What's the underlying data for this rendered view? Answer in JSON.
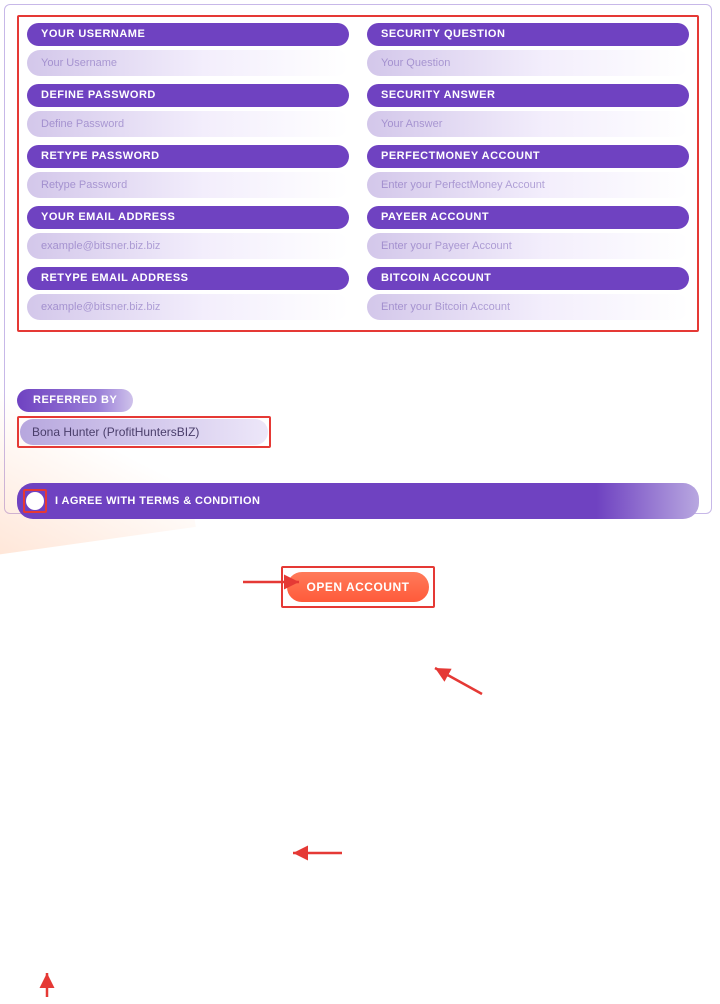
{
  "left": [
    {
      "label": "YOUR USERNAME",
      "placeholder": "Your Username"
    },
    {
      "label": "DEFINE PASSWORD",
      "placeholder": "Define Password"
    },
    {
      "label": "RETYPE PASSWORD",
      "placeholder": "Retype Password"
    },
    {
      "label": "YOUR EMAIL ADDRESS",
      "placeholder": "example@bitsner.biz.biz"
    },
    {
      "label": "RETYPE EMAIL ADDRESS",
      "placeholder": "example@bitsner.biz.biz"
    }
  ],
  "right": [
    {
      "label": "SECURITY QUESTION",
      "placeholder": "Your Question"
    },
    {
      "label": "SECURITY ANSWER",
      "placeholder": "Your Answer"
    },
    {
      "label": "PERFECTMONEY ACCOUNT",
      "placeholder": "Enter your PerfectMoney Account"
    },
    {
      "label": "PAYEER ACCOUNT",
      "placeholder": "Enter your Payeer Account"
    },
    {
      "label": "BITCOIN ACCOUNT",
      "placeholder": "Enter your Bitcoin Account"
    }
  ],
  "referred": {
    "label": "REFERRED BY",
    "value": "Bona Hunter (ProfitHuntersBIZ)"
  },
  "agree_label": "I AGREE WITH TERMS & CONDITION",
  "submit_label": "OPEN ACCOUNT",
  "colors": {
    "purple": "#6f42c1",
    "annotate": "#e53935",
    "cta": "#ff5a3a"
  }
}
